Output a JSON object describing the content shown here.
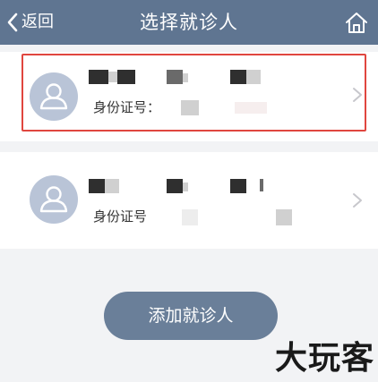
{
  "navbar": {
    "back_label": "返回",
    "title": "选择就诊人",
    "home_icon": "home-icon",
    "background": "#5f7591"
  },
  "patients": [
    {
      "name": "",
      "id_label": "身份证号：",
      "selected": true,
      "avatar_icon": "person-avatar-icon"
    },
    {
      "name": "",
      "id_label": "身份证号",
      "selected": false,
      "avatar_icon": "person-avatar-icon"
    }
  ],
  "add_button": {
    "label": "添加就诊人",
    "color": "#6a7f99"
  },
  "watermark": {
    "text": "大玩客"
  },
  "colors": {
    "highlight": "#e0463f",
    "avatar": "#b9c4d7",
    "page_background": "#f2f3f5"
  }
}
